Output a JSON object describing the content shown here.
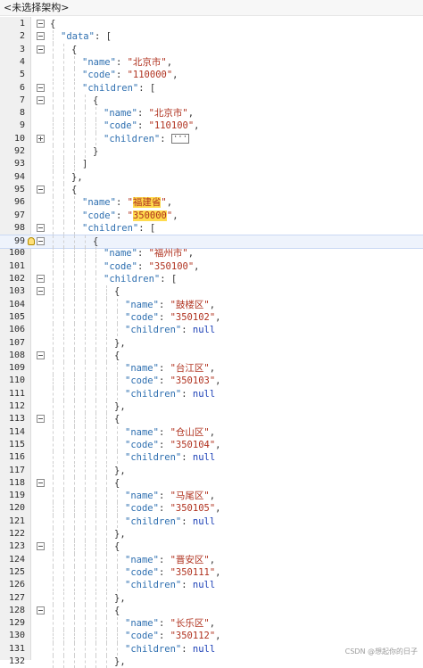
{
  "topbar": {
    "path_label": "<未选择架构>"
  },
  "watermark": "CSDN @想起你的日子",
  "lines": [
    {
      "ln": "1",
      "fold": "minus",
      "indent": 0,
      "tokens": [
        [
          "p",
          "{"
        ]
      ]
    },
    {
      "ln": "2",
      "fold": "minus",
      "indent": 1,
      "tokens": [
        [
          "k",
          "\"data\""
        ],
        [
          "p",
          ": ["
        ]
      ]
    },
    {
      "ln": "3",
      "fold": "minus",
      "indent": 2,
      "tokens": [
        [
          "p",
          "{"
        ]
      ]
    },
    {
      "ln": "4",
      "fold": "",
      "indent": 3,
      "tokens": [
        [
          "k",
          "\"name\""
        ],
        [
          "p",
          ": "
        ],
        [
          "s",
          "\"北京市\""
        ],
        [
          "p",
          ","
        ]
      ]
    },
    {
      "ln": "5",
      "fold": "",
      "indent": 3,
      "tokens": [
        [
          "k",
          "\"code\""
        ],
        [
          "p",
          ": "
        ],
        [
          "s",
          "\"110000\""
        ],
        [
          "p",
          ","
        ]
      ]
    },
    {
      "ln": "6",
      "fold": "minus",
      "indent": 3,
      "tokens": [
        [
          "k",
          "\"children\""
        ],
        [
          "p",
          ": ["
        ]
      ]
    },
    {
      "ln": "7",
      "fold": "minus",
      "indent": 4,
      "tokens": [
        [
          "p",
          "{"
        ]
      ]
    },
    {
      "ln": "8",
      "fold": "",
      "indent": 5,
      "tokens": [
        [
          "k",
          "\"name\""
        ],
        [
          "p",
          ": "
        ],
        [
          "s",
          "\"北京市\""
        ],
        [
          "p",
          ","
        ]
      ]
    },
    {
      "ln": "9",
      "fold": "",
      "indent": 5,
      "tokens": [
        [
          "k",
          "\"code\""
        ],
        [
          "p",
          ": "
        ],
        [
          "s",
          "\"110100\""
        ],
        [
          "p",
          ","
        ]
      ]
    },
    {
      "ln": "10",
      "fold": "plus",
      "indent": 5,
      "tokens": [
        [
          "k",
          "\"children\""
        ],
        [
          "p",
          ": "
        ],
        [
          "box",
          "···"
        ]
      ]
    },
    {
      "ln": "92",
      "fold": "",
      "indent": 4,
      "tokens": [
        [
          "p",
          "}"
        ]
      ]
    },
    {
      "ln": "93",
      "fold": "",
      "indent": 3,
      "tokens": [
        [
          "p",
          "]"
        ]
      ]
    },
    {
      "ln": "94",
      "fold": "",
      "indent": 2,
      "tokens": [
        [
          "p",
          "},"
        ]
      ]
    },
    {
      "ln": "95",
      "fold": "minus",
      "indent": 2,
      "tokens": [
        [
          "p",
          "{"
        ]
      ]
    },
    {
      "ln": "96",
      "fold": "",
      "indent": 3,
      "tokens": [
        [
          "k",
          "\"name\""
        ],
        [
          "p",
          ": "
        ],
        [
          "hs",
          "\"福建省\""
        ],
        [
          "p",
          ","
        ]
      ]
    },
    {
      "ln": "97",
      "fold": "",
      "indent": 3,
      "tokens": [
        [
          "k",
          "\"code\""
        ],
        [
          "p",
          ": "
        ],
        [
          "hs",
          "\"350000\""
        ],
        [
          "p",
          ","
        ]
      ]
    },
    {
      "ln": "98",
      "fold": "minus",
      "indent": 3,
      "tokens": [
        [
          "k",
          "\"children\""
        ],
        [
          "p",
          ": ["
        ]
      ]
    },
    {
      "ln": "99",
      "fold": "minus",
      "indent": 4,
      "tokens": [
        [
          "p",
          "{"
        ]
      ],
      "current": true
    },
    {
      "ln": "100",
      "fold": "",
      "indent": 5,
      "tokens": [
        [
          "k",
          "\"name\""
        ],
        [
          "p",
          ": "
        ],
        [
          "s",
          "\"福州市\""
        ],
        [
          "p",
          ","
        ]
      ]
    },
    {
      "ln": "101",
      "fold": "",
      "indent": 5,
      "tokens": [
        [
          "k",
          "\"code\""
        ],
        [
          "p",
          ": "
        ],
        [
          "s",
          "\"350100\""
        ],
        [
          "p",
          ","
        ]
      ]
    },
    {
      "ln": "102",
      "fold": "minus",
      "indent": 5,
      "tokens": [
        [
          "k",
          "\"children\""
        ],
        [
          "p",
          ": ["
        ]
      ]
    },
    {
      "ln": "103",
      "fold": "minus",
      "indent": 6,
      "tokens": [
        [
          "p",
          "{"
        ]
      ]
    },
    {
      "ln": "104",
      "fold": "",
      "indent": 7,
      "tokens": [
        [
          "k",
          "\"name\""
        ],
        [
          "p",
          ": "
        ],
        [
          "s",
          "\"鼓楼区\""
        ],
        [
          "p",
          ","
        ]
      ]
    },
    {
      "ln": "105",
      "fold": "",
      "indent": 7,
      "tokens": [
        [
          "k",
          "\"code\""
        ],
        [
          "p",
          ": "
        ],
        [
          "s",
          "\"350102\""
        ],
        [
          "p",
          ","
        ]
      ]
    },
    {
      "ln": "106",
      "fold": "",
      "indent": 7,
      "tokens": [
        [
          "k",
          "\"children\""
        ],
        [
          "p",
          ": "
        ],
        [
          "n",
          "null"
        ]
      ]
    },
    {
      "ln": "107",
      "fold": "",
      "indent": 6,
      "tokens": [
        [
          "p",
          "},"
        ]
      ]
    },
    {
      "ln": "108",
      "fold": "minus",
      "indent": 6,
      "tokens": [
        [
          "p",
          "{"
        ]
      ]
    },
    {
      "ln": "109",
      "fold": "",
      "indent": 7,
      "tokens": [
        [
          "k",
          "\"name\""
        ],
        [
          "p",
          ": "
        ],
        [
          "s",
          "\"台江区\""
        ],
        [
          "p",
          ","
        ]
      ]
    },
    {
      "ln": "110",
      "fold": "",
      "indent": 7,
      "tokens": [
        [
          "k",
          "\"code\""
        ],
        [
          "p",
          ": "
        ],
        [
          "s",
          "\"350103\""
        ],
        [
          "p",
          ","
        ]
      ]
    },
    {
      "ln": "111",
      "fold": "",
      "indent": 7,
      "tokens": [
        [
          "k",
          "\"children\""
        ],
        [
          "p",
          ": "
        ],
        [
          "n",
          "null"
        ]
      ]
    },
    {
      "ln": "112",
      "fold": "",
      "indent": 6,
      "tokens": [
        [
          "p",
          "},"
        ]
      ]
    },
    {
      "ln": "113",
      "fold": "minus",
      "indent": 6,
      "tokens": [
        [
          "p",
          "{"
        ]
      ]
    },
    {
      "ln": "114",
      "fold": "",
      "indent": 7,
      "tokens": [
        [
          "k",
          "\"name\""
        ],
        [
          "p",
          ": "
        ],
        [
          "s",
          "\"仓山区\""
        ],
        [
          "p",
          ","
        ]
      ]
    },
    {
      "ln": "115",
      "fold": "",
      "indent": 7,
      "tokens": [
        [
          "k",
          "\"code\""
        ],
        [
          "p",
          ": "
        ],
        [
          "s",
          "\"350104\""
        ],
        [
          "p",
          ","
        ]
      ]
    },
    {
      "ln": "116",
      "fold": "",
      "indent": 7,
      "tokens": [
        [
          "k",
          "\"children\""
        ],
        [
          "p",
          ": "
        ],
        [
          "n",
          "null"
        ]
      ]
    },
    {
      "ln": "117",
      "fold": "",
      "indent": 6,
      "tokens": [
        [
          "p",
          "},"
        ]
      ]
    },
    {
      "ln": "118",
      "fold": "minus",
      "indent": 6,
      "tokens": [
        [
          "p",
          "{"
        ]
      ]
    },
    {
      "ln": "119",
      "fold": "",
      "indent": 7,
      "tokens": [
        [
          "k",
          "\"name\""
        ],
        [
          "p",
          ": "
        ],
        [
          "s",
          "\"马尾区\""
        ],
        [
          "p",
          ","
        ]
      ]
    },
    {
      "ln": "120",
      "fold": "",
      "indent": 7,
      "tokens": [
        [
          "k",
          "\"code\""
        ],
        [
          "p",
          ": "
        ],
        [
          "s",
          "\"350105\""
        ],
        [
          "p",
          ","
        ]
      ]
    },
    {
      "ln": "121",
      "fold": "",
      "indent": 7,
      "tokens": [
        [
          "k",
          "\"children\""
        ],
        [
          "p",
          ": "
        ],
        [
          "n",
          "null"
        ]
      ]
    },
    {
      "ln": "122",
      "fold": "",
      "indent": 6,
      "tokens": [
        [
          "p",
          "},"
        ]
      ]
    },
    {
      "ln": "123",
      "fold": "minus",
      "indent": 6,
      "tokens": [
        [
          "p",
          "{"
        ]
      ]
    },
    {
      "ln": "124",
      "fold": "",
      "indent": 7,
      "tokens": [
        [
          "k",
          "\"name\""
        ],
        [
          "p",
          ": "
        ],
        [
          "s",
          "\"晋安区\""
        ],
        [
          "p",
          ","
        ]
      ]
    },
    {
      "ln": "125",
      "fold": "",
      "indent": 7,
      "tokens": [
        [
          "k",
          "\"code\""
        ],
        [
          "p",
          ": "
        ],
        [
          "s",
          "\"350111\""
        ],
        [
          "p",
          ","
        ]
      ]
    },
    {
      "ln": "126",
      "fold": "",
      "indent": 7,
      "tokens": [
        [
          "k",
          "\"children\""
        ],
        [
          "p",
          ": "
        ],
        [
          "n",
          "null"
        ]
      ]
    },
    {
      "ln": "127",
      "fold": "",
      "indent": 6,
      "tokens": [
        [
          "p",
          "},"
        ]
      ]
    },
    {
      "ln": "128",
      "fold": "minus",
      "indent": 6,
      "tokens": [
        [
          "p",
          "{"
        ]
      ]
    },
    {
      "ln": "129",
      "fold": "",
      "indent": 7,
      "tokens": [
        [
          "k",
          "\"name\""
        ],
        [
          "p",
          ": "
        ],
        [
          "s",
          "\"长乐区\""
        ],
        [
          "p",
          ","
        ]
      ]
    },
    {
      "ln": "130",
      "fold": "",
      "indent": 7,
      "tokens": [
        [
          "k",
          "\"code\""
        ],
        [
          "p",
          ": "
        ],
        [
          "s",
          "\"350112\""
        ],
        [
          "p",
          ","
        ]
      ]
    },
    {
      "ln": "131",
      "fold": "",
      "indent": 7,
      "tokens": [
        [
          "k",
          "\"children\""
        ],
        [
          "p",
          ": "
        ],
        [
          "n",
          "null"
        ]
      ]
    },
    {
      "ln": "132",
      "fold": "",
      "indent": 6,
      "tokens": [
        [
          "p",
          "},"
        ]
      ]
    }
  ]
}
